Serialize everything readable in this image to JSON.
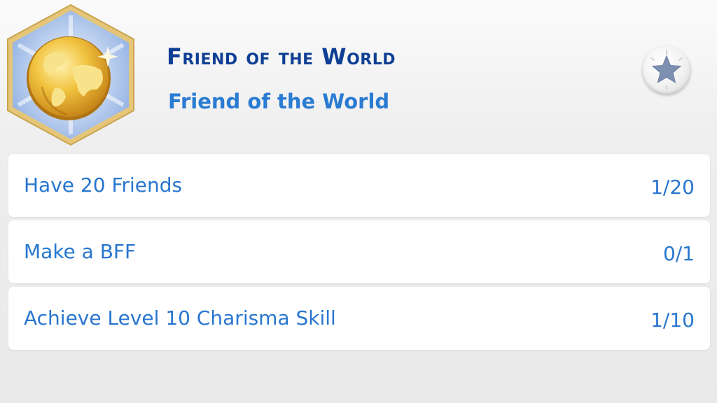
{
  "aspiration": {
    "title": "Friend of the World",
    "subtitle": "Friend of the World",
    "badge_icon": "golden-globe-icon",
    "reward_icon": "star-icon",
    "colors": {
      "title": "#0f3f94",
      "text": "#2876cf",
      "badge_frame": "#e2c276",
      "badge_fill": "#9fbbe6"
    }
  },
  "goals": [
    {
      "label": "Have 20 Friends",
      "progress": "1/20"
    },
    {
      "label": "Make a BFF",
      "progress": "0/1"
    },
    {
      "label": "Achieve Level 10 Charisma Skill",
      "progress": "1/10"
    }
  ]
}
